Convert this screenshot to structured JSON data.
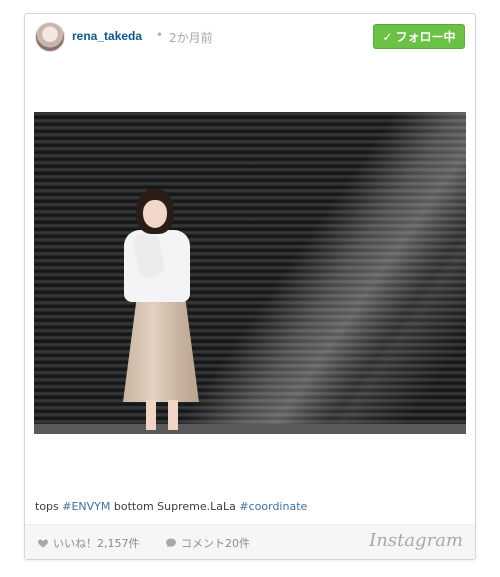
{
  "post": {
    "username": "rena_takeda",
    "separator": "•",
    "time_ago": "2か月前",
    "follow_button": "フォロー中",
    "follow_check": "✓"
  },
  "caption": {
    "part1": "tops ",
    "tag1": "#ENVYM",
    "part2": " bottom Supreme.LaLa ",
    "tag2": "#coordinate"
  },
  "footer": {
    "likes_label": "いいね！2,157件",
    "comments_label": "コメント20件",
    "brand": "Instagram"
  },
  "icons": {
    "like": "heart-icon",
    "comment": "comment-bubble-icon",
    "check": "check-icon"
  },
  "colors": {
    "follow_bg": "#6bc046",
    "username": "#125688",
    "hashtag": "#3f729b"
  }
}
